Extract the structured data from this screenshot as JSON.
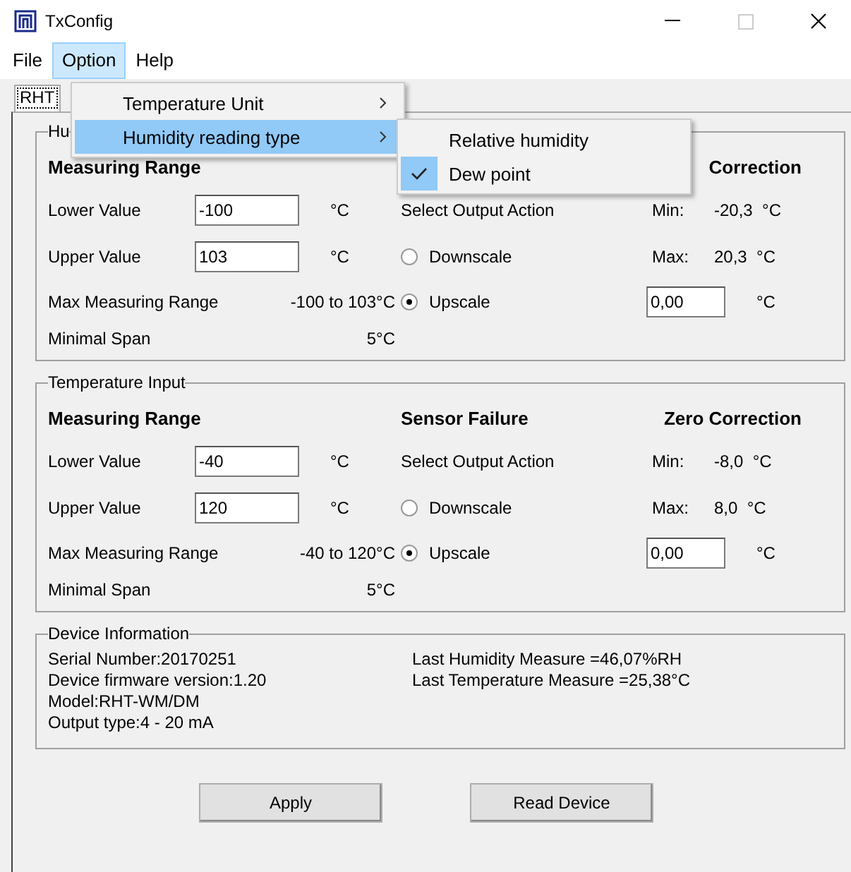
{
  "window": {
    "title": "TxConfig"
  },
  "menu_bar": [
    {
      "label": "File",
      "selected": false
    },
    {
      "label": "Option",
      "selected": true
    },
    {
      "label": "Help",
      "selected": false
    }
  ],
  "option_menu": {
    "items": [
      {
        "label": "Temperature Unit",
        "selected": false
      },
      {
        "label": "Humidity reading type",
        "selected": true
      }
    ]
  },
  "submenu": {
    "items": [
      {
        "label": "Relative humidity",
        "checked": false
      },
      {
        "label": "Dew point",
        "checked": true
      }
    ]
  },
  "tabs": [
    {
      "label": "RHT",
      "selected": true
    }
  ],
  "groups": [
    {
      "legend": "Hu",
      "measuring_range": {
        "title": "Measuring Range",
        "lower": {
          "label": "Lower Value",
          "value": "-100",
          "unit": "°C"
        },
        "upper": {
          "label": "Upper Value",
          "value": "103",
          "unit": "°C"
        },
        "max_range": {
          "label": "Max Measuring Range",
          "value": "-100 to 103°C"
        },
        "minimal_span": {
          "label": "Minimal Span",
          "value": "5°C"
        }
      },
      "sensor_failure": {
        "action_label": "Select Output Action",
        "options": [
          {
            "label": "Downscale",
            "selected": false
          },
          {
            "label": "Upscale",
            "selected": true
          }
        ]
      },
      "zero_correction": {
        "title": "Correction",
        "min": {
          "label": "Min:",
          "value": "-20,3",
          "unit": "°C"
        },
        "max": {
          "label": "Max:",
          "value": "20,3",
          "unit": "°C"
        },
        "offset": {
          "value": "0,00",
          "unit": "°C"
        }
      }
    },
    {
      "legend": "Temperature Input",
      "measuring_range": {
        "title": "Measuring Range",
        "lower": {
          "label": "Lower Value",
          "value": "-40",
          "unit": "°C"
        },
        "upper": {
          "label": "Upper Value",
          "value": "120",
          "unit": "°C"
        },
        "max_range": {
          "label": "Max Measuring Range",
          "value": "-40 to 120°C"
        },
        "minimal_span": {
          "label": "Minimal Span",
          "value": "5°C"
        }
      },
      "sensor_failure": {
        "title": "Sensor Failure",
        "action_label": "Select Output Action",
        "options": [
          {
            "label": "Downscale",
            "selected": false
          },
          {
            "label": "Upscale",
            "selected": true
          }
        ]
      },
      "zero_correction": {
        "title": "Zero Correction",
        "min": {
          "label": "Min:",
          "value": "-8,0",
          "unit": "°C"
        },
        "max": {
          "label": "Max:",
          "value": "8,0",
          "unit": "°C"
        },
        "offset": {
          "value": "0,00",
          "unit": "°C"
        }
      }
    }
  ],
  "device_information": {
    "legend": "Device Information",
    "left": [
      "Serial Number:20170251",
      "Device firmware version:1.20",
      "Model:RHT-WM/DM",
      "Output type:4 - 20 mA"
    ],
    "right": [
      "Last Humidity Measure =46,07%RH",
      "Last Temperature Measure =25,38°C"
    ]
  },
  "buttons": [
    "Apply",
    "Read Device"
  ]
}
